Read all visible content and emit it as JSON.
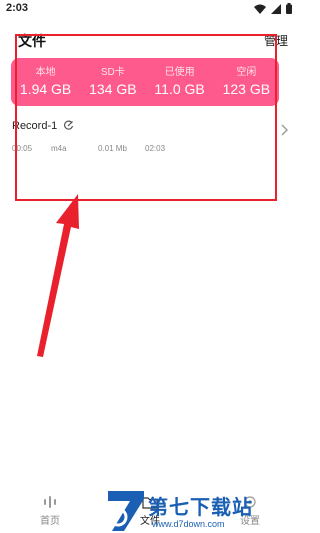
{
  "status_bar": {
    "time": "2:03"
  },
  "header": {
    "title": "文件",
    "manage_label": "管理"
  },
  "storage": [
    {
      "label": "本地",
      "value": "1.94 GB"
    },
    {
      "label": "SD卡",
      "value": "134 GB"
    },
    {
      "label": "已使用",
      "value": "11.0 GB"
    },
    {
      "label": "空闲",
      "value": "123 GB"
    }
  ],
  "records": [
    {
      "name": "Record-1",
      "duration": "00:05",
      "format": "m4a",
      "size": "0.01 Mb",
      "date": "02:03"
    }
  ],
  "bottom_nav": [
    {
      "label": "首页",
      "icon": "waveform-icon"
    },
    {
      "label": "文件",
      "icon": "folder-icon"
    },
    {
      "label": "设置",
      "icon": "settings-icon"
    }
  ],
  "watermark": {
    "text": "第七下载站",
    "url": "www.d7down.com"
  },
  "colors": {
    "accent": "#ff5a8d",
    "annotation": "#e9212d",
    "watermark": "#1a5fb4"
  }
}
